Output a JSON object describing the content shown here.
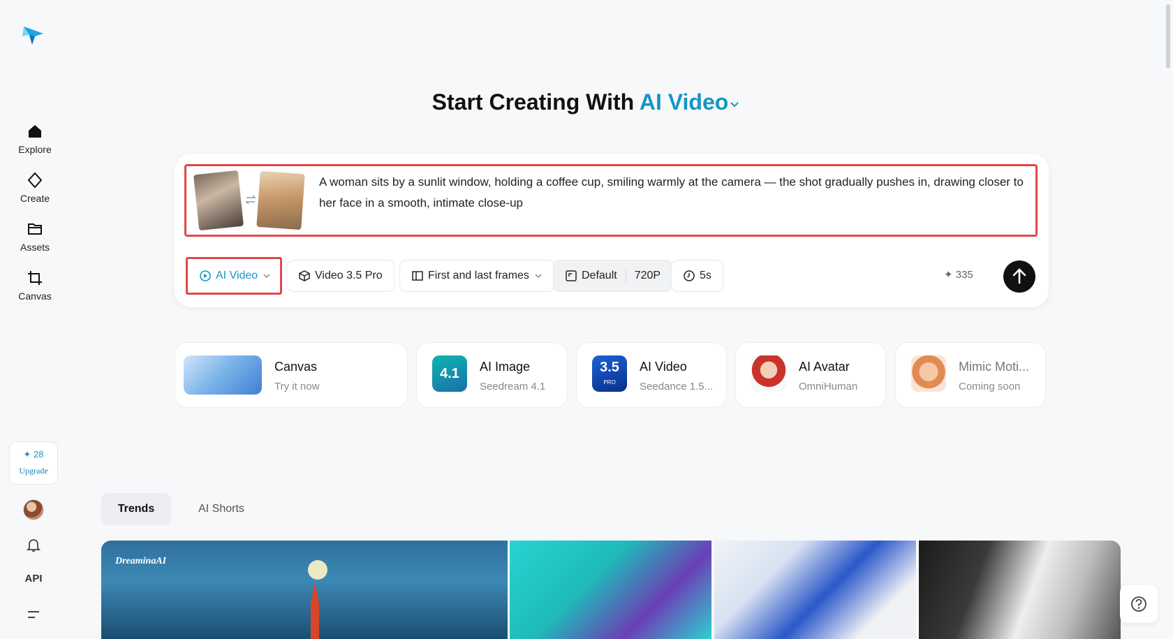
{
  "sidebar": {
    "items": [
      {
        "label": "Explore"
      },
      {
        "label": "Create"
      },
      {
        "label": "Assets"
      },
      {
        "label": "Canvas"
      }
    ],
    "upgrade": {
      "credits": "28",
      "label": "Upgrade"
    },
    "api_label": "API"
  },
  "heading": {
    "prefix": "Start Creating With",
    "accent": "AI Video"
  },
  "prompt": {
    "text": "A woman sits by a sunlit window, holding a coffee cup, smiling warmly at the camera — the shot gradually pushes in, drawing closer to her face in a smooth, intimate close-up"
  },
  "toolbar": {
    "mode_label": "AI Video",
    "model_label": "Video 3.5 Pro",
    "frames_label": "First and last frames",
    "ratio_label": "Default",
    "resolution_label": "720P",
    "duration_label": "5s",
    "cost": "335"
  },
  "features": [
    {
      "title": "Canvas",
      "sub": "Try it now"
    },
    {
      "title": "AI Image",
      "sub": "Seedream 4.1",
      "badge": "4.1"
    },
    {
      "title": "AI Video",
      "sub": "Seedance 1.5...",
      "badge": "3.5",
      "badge_sub": "PRO"
    },
    {
      "title": "AI Avatar",
      "sub": "OmniHuman"
    },
    {
      "title": "Mimic Moti...",
      "sub": "Coming soon"
    }
  ],
  "tabs": [
    {
      "label": "Trends"
    },
    {
      "label": "AI Shorts"
    }
  ],
  "gallery": {
    "logo_text": "DreaminaAI"
  },
  "colors": {
    "accent": "#1497c4",
    "highlight": "#e0484a"
  }
}
